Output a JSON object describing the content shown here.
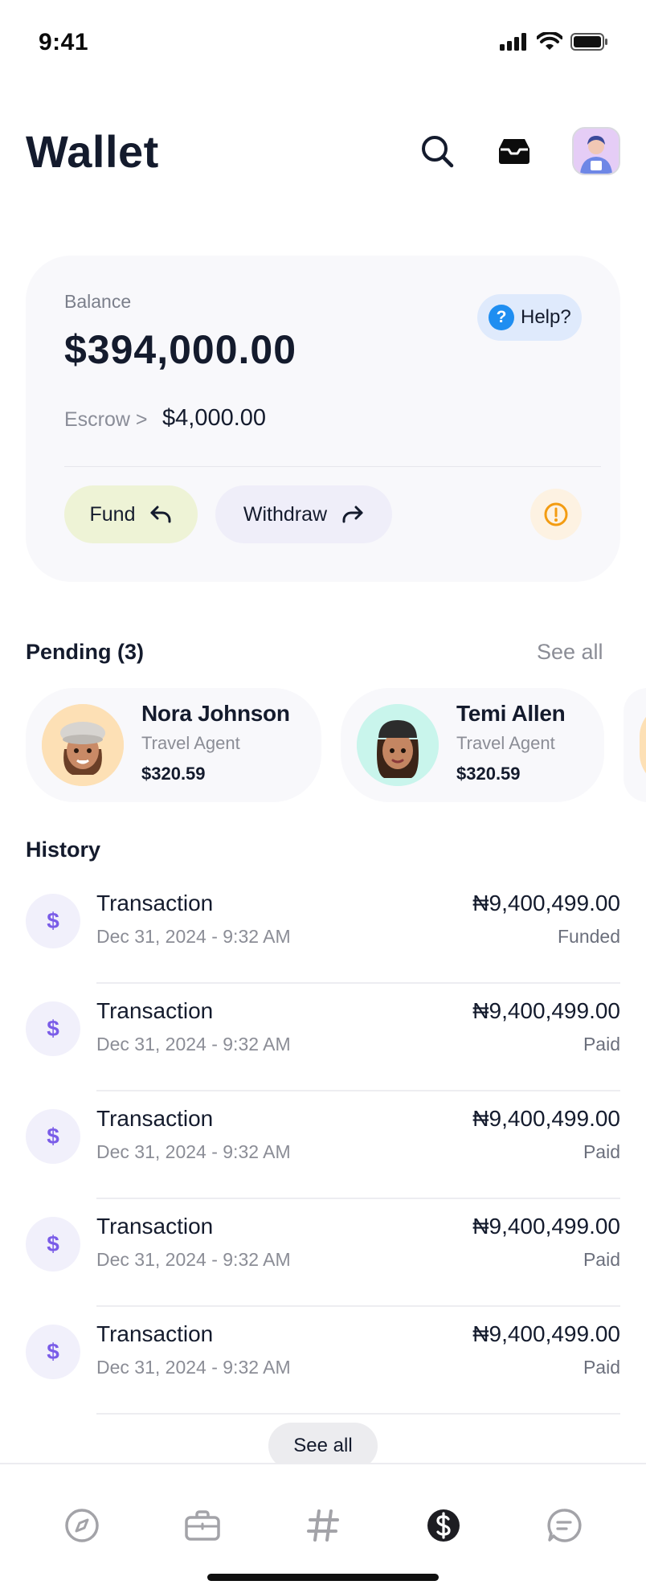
{
  "status_bar": {
    "time": "9:41"
  },
  "header": {
    "title": "Wallet"
  },
  "balance_card": {
    "balance_label": "Balance",
    "balance_value": "$394,000.00",
    "help_label": "Help?",
    "escrow_label": "Escrow >",
    "escrow_value": "$4,000.00",
    "fund_label": "Fund",
    "withdraw_label": "Withdraw"
  },
  "pending": {
    "title": "Pending (3)",
    "see_all": "See all",
    "items": [
      {
        "name": "Nora Johnson",
        "role": "Travel Agent",
        "amount": "$320.59"
      },
      {
        "name": "Temi Allen",
        "role": "Travel Agent",
        "amount": "$320.59"
      }
    ]
  },
  "history": {
    "title": "History",
    "see_all": "See all",
    "items": [
      {
        "title": "Transaction",
        "date": "Dec 31, 2024 - 9:32 AM",
        "amount": "₦9,400,499.00",
        "status": "Funded"
      },
      {
        "title": "Transaction",
        "date": "Dec 31, 2024 - 9:32 AM",
        "amount": "₦9,400,499.00",
        "status": "Paid"
      },
      {
        "title": "Transaction",
        "date": "Dec 31, 2024 - 9:32 AM",
        "amount": "₦9,400,499.00",
        "status": "Paid"
      },
      {
        "title": "Transaction",
        "date": "Dec 31, 2024 - 9:32 AM",
        "amount": "₦9,400,499.00",
        "status": "Paid"
      },
      {
        "title": "Transaction",
        "date": "Dec 31, 2024 - 9:32 AM",
        "amount": "₦9,400,499.00",
        "status": "Paid"
      }
    ]
  },
  "nav": {
    "items": [
      "compass-icon",
      "briefcase-icon",
      "hashtag-icon",
      "dollar-icon",
      "chat-icon"
    ],
    "active": "dollar-icon"
  },
  "colors": {
    "fund_bg": "#eef3d6",
    "withdraw_bg": "#efeef9",
    "help_blue": "#1f8ef1",
    "alert_orange": "#f39c12",
    "tx_icon_purple": "#7a5ce8"
  }
}
